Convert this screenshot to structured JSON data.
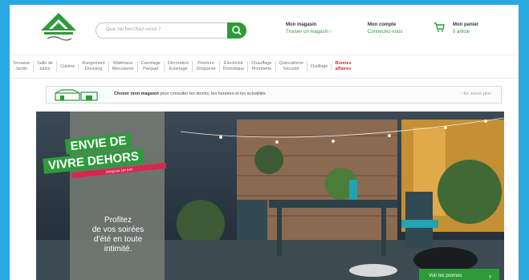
{
  "header": {
    "logo_alt": "Leroy Merlin",
    "search_placeholder": "Que recherchez-vous ?",
    "store": {
      "title": "Mon magasin",
      "sub": "Trouver un magasin  ›"
    },
    "account": {
      "title": "Mon compte",
      "sub": "Connectez-vous"
    },
    "cart": {
      "title": "Mon panier",
      "sub": "0 article"
    }
  },
  "nav": [
    "Terrasse\nJardin",
    "Salle de\nbains",
    "Cuisine",
    "Rangement\nDressing",
    "Matériaux\nMenuiserie",
    "Carrelage\nParquet",
    "Décoration\nÉclairage",
    "Peinture\nDroguerie",
    "Électricité\nDomotique",
    "Chauffage\nPlomberie",
    "Quincaillerie\nSécurité",
    "Outillage",
    "Bonnes\naffaires"
  ],
  "storebar": {
    "lead": "Choisir mon magasin",
    "text": " pour consulter les stocks, les horaires et les actualités",
    "more": "› En savoir plus"
  },
  "hero": {
    "banner_line1": "ENVIE DE",
    "banner_line2": "VIVRE DEHORS",
    "banner_date": "Jusqu'au 1er juin",
    "body": "Profitez\nde vos soirées\nd'été en toute\nintimité.",
    "cta": "Voir les promos"
  },
  "colors": {
    "frame": "#29a9e0",
    "brand_green": "#2e9b3a",
    "promo_red": "#d3302f",
    "pink": "#d8264f"
  }
}
